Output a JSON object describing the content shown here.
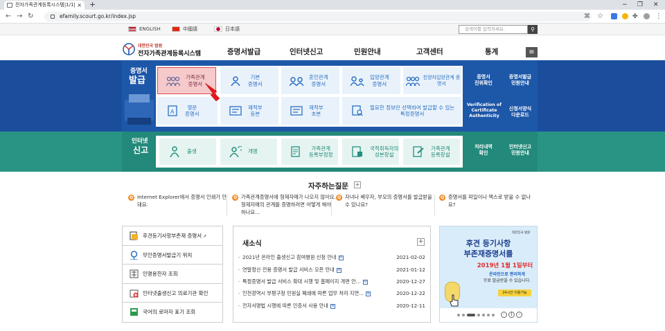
{
  "browser": {
    "tab_title": "전자가족관계등록시스템|1/1|",
    "url": "efamily.scourt.go.kr/index.jsp",
    "window_controls": [
      "−",
      "❐",
      "✕"
    ]
  },
  "langbar": {
    "languages": [
      "ENGLISH",
      "中國語",
      "日本語"
    ],
    "search_placeholder": "검색어를 입력하세요."
  },
  "header": {
    "logo_sub": "대한민국 법원",
    "logo_main": "전자가족관계등록시스템",
    "menu": [
      "증명서발급",
      "인터넷신고",
      "민원안내",
      "고객센터",
      "통계"
    ]
  },
  "issue": {
    "section_label_top": "증명서",
    "section_label_bottom": "발급",
    "cards_row1": [
      {
        "label": "가족관계\n증명서",
        "icon": "family-icon"
      },
      {
        "label": "기본\n증명서",
        "icon": "person-icon"
      },
      {
        "label": "혼인관계\n증명서",
        "icon": "couple-icon"
      },
      {
        "label": "입양관계\n증명서",
        "icon": "adoption-icon"
      },
      {
        "label": "친양자입양관계\n증명서",
        "icon": "adoption-icon"
      }
    ],
    "cards_row2": [
      {
        "label": "영문\n증명서",
        "icon": "document-a-icon"
      },
      {
        "label": "제적부\n등본",
        "icon": "register-icon"
      },
      {
        "label": "제적부\n초본",
        "icon": "register-icon"
      },
      {
        "label": "필요한 정보만 선택하여 발급할 수 있는\n특정증명서",
        "icon": "search-doc-icon"
      }
    ],
    "right_links": [
      {
        "label": "증명서\n진위확인"
      },
      {
        "label": "증명서발급\n민원안내"
      },
      {
        "label": "Verification of\nCertificate\nAuthenticity"
      },
      {
        "label": "신청서양식\n다운로드"
      }
    ]
  },
  "report": {
    "section_label_top": "인터넷",
    "section_label_bottom": "신고",
    "cards": [
      {
        "label": "출생",
        "icon": "birth-icon"
      },
      {
        "label": "개명",
        "icon": "rename-icon"
      },
      {
        "label": "가족관계\n등록부정정",
        "icon": "edit-doc-icon"
      },
      {
        "label": "국적취득자의\n성본창설",
        "icon": "nationality-icon"
      },
      {
        "label": "가족관계\n등록창설",
        "icon": "create-doc-icon"
      }
    ],
    "right_links": [
      {
        "label": "처리내역\n확인"
      },
      {
        "label": "인터넷신고\n민원안내"
      }
    ]
  },
  "faq": {
    "title": "자주하는질문",
    "items": [
      "Internet Explorer에서 증명서 인쇄가 안돼요.",
      "가족관계증명서에 형제자매가 나오지 않아요. 형제자매의 관계를 증명하려면 어떻게 해야 하나요...",
      "자녀나 배우자, 부모의 증명서를 발급받을 수 있나요?",
      "증명서를 파일이나 팩스로 받을 수 없나요?"
    ]
  },
  "quicklinks": [
    {
      "label": "후견등기사항부존재 증명서",
      "icon": "certificate-icon"
    },
    {
      "label": "무인증명서발급기 위치",
      "icon": "location-icon"
    },
    {
      "label": "인명용한자 조회",
      "icon": "hanja-icon"
    },
    {
      "label": "인터넷출생신고 의료기관 확인",
      "icon": "hospital-icon"
    },
    {
      "label": "국어의 로마자 표기 조회",
      "icon": "book-icon"
    }
  ],
  "news": {
    "title": "새소식",
    "items": [
      {
        "title": "2021년 온라인 출생신고 참여병원 신청 안내",
        "date": "2021-02-02"
      },
      {
        "title": "연말정산 전용 증명서 발급 서비스 오픈 안내",
        "date": "2021-01-12"
      },
      {
        "title": "특정증명서 발급 서비스 확대 시행 및 홈페이지 개편 안...",
        "date": "2020-12-27"
      },
      {
        "title": "인천광역시 부평구청 민원실 폐쇄에 따른 업무 처리 지연...",
        "date": "2020-12-22"
      },
      {
        "title": "전자서명법 시행에 따른 인증서 사용 안내",
        "date": "2020-12-11"
      }
    ]
  },
  "banner": {
    "org": "대한민국 법원",
    "line1": "후견 등기사항",
    "line2": "부존재증명서를",
    "line3": "2019년 1월 1일부터",
    "line4a": "온라인으로 편리하게",
    "line4b": "무료 발급받을 수 있습니다.",
    "badge": "24시간 이용가능"
  }
}
